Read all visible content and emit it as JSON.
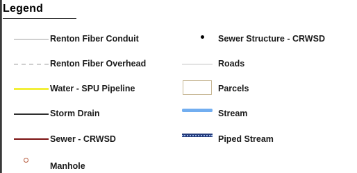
{
  "legend": {
    "title": "Legend",
    "left_items": [
      {
        "label": "Renton Fiber Conduit",
        "symbol": "fiber-conduit-line",
        "color": "#d0d0d0"
      },
      {
        "label": "Renton Fiber Overhead",
        "symbol": "fiber-overhead-dashed-line",
        "color": "#cfcfcf"
      },
      {
        "label": "Water - SPU Pipeline",
        "symbol": "water-pipeline-line",
        "color": "#f2ef3a"
      },
      {
        "label": "Storm Drain",
        "symbol": "storm-drain-line",
        "color": "#2f2f2f"
      },
      {
        "label": "Sewer - CRWSD",
        "symbol": "sewer-line",
        "color": "#7a1010"
      },
      {
        "label": "Manhole",
        "symbol": "manhole-circle",
        "color": "#b65a3c"
      }
    ],
    "right_items": [
      {
        "label": "Sewer Structure - CRWSD",
        "symbol": "sewer-structure-dot",
        "color": "#000000"
      },
      {
        "label": "Roads",
        "symbol": "roads-line",
        "color": "#e3e3e3"
      },
      {
        "label": "Parcels",
        "symbol": "parcel-box",
        "color": "#c8b896"
      },
      {
        "label": "Stream",
        "symbol": "stream-line",
        "color": "#72aef0"
      },
      {
        "label": "Piped Stream",
        "symbol": "piped-stream-line",
        "color": "#233b7a"
      }
    ]
  }
}
